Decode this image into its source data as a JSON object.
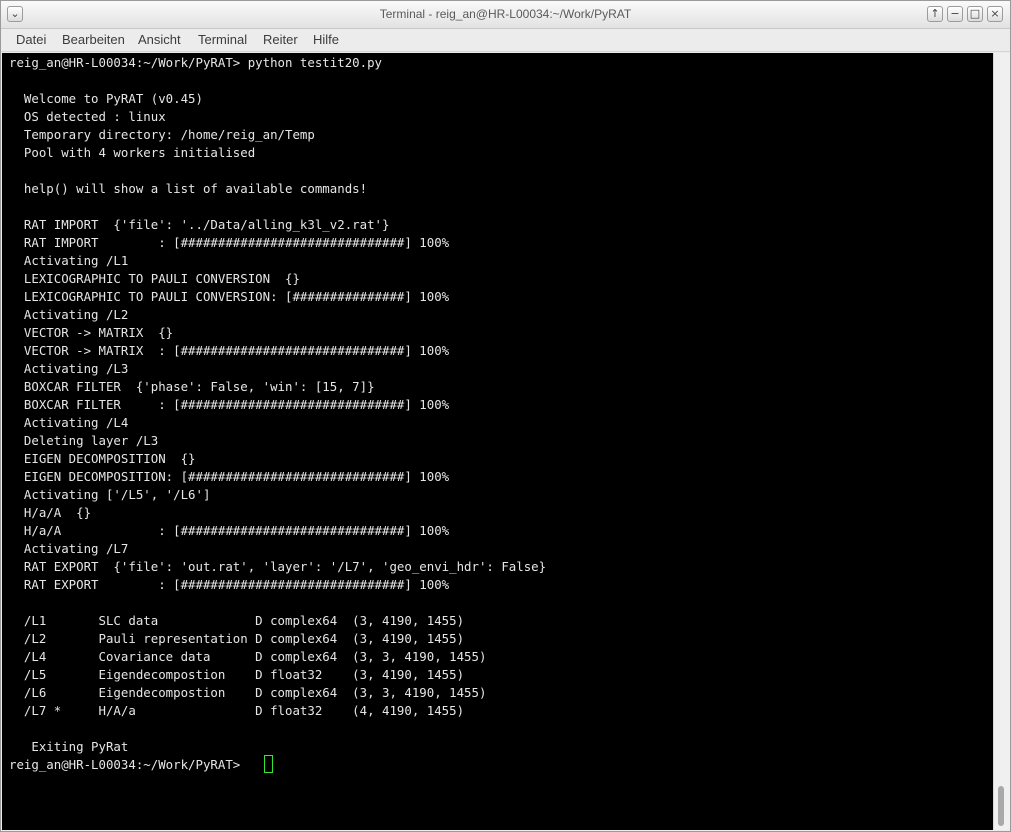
{
  "window": {
    "title": "Terminal - reig_an@HR-L00034:~/Work/PyRAT",
    "menu_glyph": "⌄",
    "buttons": {
      "raise": "↑",
      "minimize": "−",
      "maximize": "□",
      "close": "×"
    }
  },
  "menu": [
    "Datei",
    "Bearbeiten",
    "Ansicht",
    "Terminal",
    "Reiter",
    "Hilfe"
  ],
  "terminal": {
    "lines": [
      "reig_an@HR-L00034:~/Work/PyRAT> python testit20.py",
      "",
      "  Welcome to PyRAT (v0.45)",
      "  OS detected : linux",
      "  Temporary directory: /home/reig_an/Temp",
      "  Pool with 4 workers initialised",
      "",
      "  help() will show a list of available commands!",
      "",
      "  RAT IMPORT  {'file': '../Data/alling_k3l_v2.rat'}",
      "  RAT IMPORT        : [##############################] 100%",
      "  Activating /L1",
      "  LEXICOGRAPHIC TO PAULI CONVERSION  {}",
      "  LEXICOGRAPHIC TO PAULI CONVERSION: [###############] 100%",
      "  Activating /L2",
      "  VECTOR -> MATRIX  {}",
      "  VECTOR -> MATRIX  : [##############################] 100%",
      "  Activating /L3",
      "  BOXCAR FILTER  {'phase': False, 'win': [15, 7]}",
      "  BOXCAR FILTER     : [##############################] 100%",
      "  Activating /L4",
      "  Deleting layer /L3",
      "  EIGEN DECOMPOSITION  {}",
      "  EIGEN DECOMPOSITION: [#############################] 100%",
      "  Activating ['/L5', '/L6']",
      "  H/a/A  {}",
      "  H/a/A             : [##############################] 100%",
      "  Activating /L7",
      "  RAT EXPORT  {'file': 'out.rat', 'layer': '/L7', 'geo_envi_hdr': False}",
      "  RAT EXPORT        : [##############################] 100%",
      "",
      "  /L1       SLC data             D complex64  (3, 4190, 1455)",
      "  /L2       Pauli representation D complex64  (3, 4190, 1455)",
      "  /L4       Covariance data      D complex64  (3, 3, 4190, 1455)",
      "  /L5       Eigendecompostion    D float32    (3, 4190, 1455)",
      "  /L6       Eigendecompostion    D complex64  (3, 3, 4190, 1455)",
      "  /L7 *     H/A/a                D float32    (4, 4190, 1455)",
      "",
      "   Exiting PyRat",
      "reig_an@HR-L00034:~/Work/PyRAT> "
    ]
  },
  "colors": {
    "background": "#000000",
    "text": "#e6e6e6",
    "cursor": "#35e635"
  }
}
